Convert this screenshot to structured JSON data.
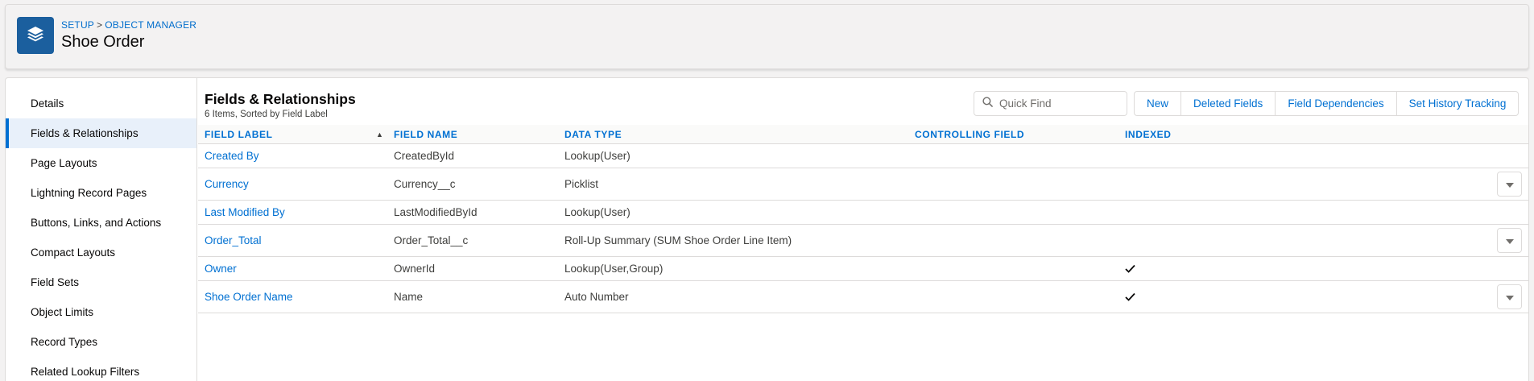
{
  "header": {
    "breadcrumb": [
      "SETUP",
      "OBJECT MANAGER"
    ],
    "breadcrumb_sep": ">",
    "title": "Shoe Order",
    "icon": "layers-icon"
  },
  "sidebar": {
    "items": [
      {
        "label": "Details"
      },
      {
        "label": "Fields & Relationships",
        "active": true
      },
      {
        "label": "Page Layouts"
      },
      {
        "label": "Lightning Record Pages"
      },
      {
        "label": "Buttons, Links, and Actions"
      },
      {
        "label": "Compact Layouts"
      },
      {
        "label": "Field Sets"
      },
      {
        "label": "Object Limits"
      },
      {
        "label": "Record Types"
      },
      {
        "label": "Related Lookup Filters"
      }
    ]
  },
  "main": {
    "title": "Fields & Relationships",
    "subtitle": "6 Items, Sorted by Field Label",
    "search": {
      "placeholder": "Quick Find",
      "value": ""
    },
    "buttons": [
      "New",
      "Deleted Fields",
      "Field Dependencies",
      "Set History Tracking"
    ]
  },
  "table": {
    "columns": [
      "FIELD LABEL",
      "FIELD NAME",
      "DATA TYPE",
      "CONTROLLING FIELD",
      "INDEXED"
    ],
    "sort_indicator": "▲",
    "rows": [
      {
        "label": "Created By",
        "name": "CreatedById",
        "type": "Lookup(User)",
        "controlling": "",
        "indexed": false,
        "menu": false
      },
      {
        "label": "Currency",
        "name": "Currency__c",
        "type": "Picklist",
        "controlling": "",
        "indexed": false,
        "menu": true
      },
      {
        "label": "Last Modified By",
        "name": "LastModifiedById",
        "type": "Lookup(User)",
        "controlling": "",
        "indexed": false,
        "menu": false
      },
      {
        "label": "Order_Total",
        "name": "Order_Total__c",
        "type": "Roll-Up Summary (SUM Shoe Order Line Item)",
        "controlling": "",
        "indexed": false,
        "menu": true
      },
      {
        "label": "Owner",
        "name": "OwnerId",
        "type": "Lookup(User,Group)",
        "controlling": "",
        "indexed": true,
        "menu": false
      },
      {
        "label": "Shoe Order Name",
        "name": "Name",
        "type": "Auto Number",
        "controlling": "",
        "indexed": true,
        "menu": true
      }
    ]
  },
  "colors": {
    "accent": "#0070d2",
    "header_icon_bg": "#1b5f9e",
    "active_item_bg": "#e8f0fa"
  }
}
